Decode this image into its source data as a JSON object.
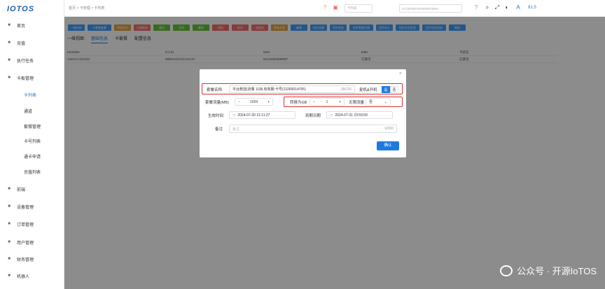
{
  "app": {
    "logo": "IOTOS",
    "breadcrumb": "首页 > 卡管理 > 卡列表"
  },
  "sidebar": {
    "items": [
      {
        "icon": "home-icon",
        "label": "首页"
      },
      {
        "icon": "recharge-icon",
        "label": "充值"
      },
      {
        "icon": "task-icon",
        "label": "执行任务"
      },
      {
        "icon": "card-icon",
        "label": "卡板管理"
      },
      {
        "icon": "",
        "label": "卡列表",
        "sub": true,
        "active": true
      },
      {
        "icon": "",
        "label": "通道",
        "sub": true
      },
      {
        "icon": "",
        "label": "套餐管理",
        "sub": true
      },
      {
        "icon": "",
        "label": "卡号列表",
        "sub": true
      },
      {
        "icon": "",
        "label": "通卡申请",
        "sub": true
      },
      {
        "icon": "",
        "label": "充值列表",
        "sub": true
      },
      {
        "icon": "link-icon",
        "label": "前端"
      },
      {
        "icon": "device-icon",
        "label": "设备管理"
      },
      {
        "icon": "order-icon",
        "label": "订单管理"
      },
      {
        "icon": "user-icon",
        "label": "用户管理"
      },
      {
        "icon": "finance-icon",
        "label": "财务管理"
      },
      {
        "icon": "robot-icon",
        "label": "机器人"
      }
    ]
  },
  "topbar": {
    "search_placeholder": "卡列表",
    "iccid_placeholder": "ICCID/MSISDN/IMSI/IMEI",
    "badge": "81.5"
  },
  "toolbar": {
    "buttons": [
      {
        "label": "一键分析",
        "color": "#409eff"
      },
      {
        "label": "卡套餐变更",
        "color": "#409eff"
      },
      {
        "label": "停机保号",
        "color": "#e6a23c"
      },
      {
        "label": "达量断网",
        "color": "#f56c6c"
      },
      {
        "label": "复机",
        "color": "#67c23a"
      },
      {
        "label": "开机",
        "color": "#67c23a"
      },
      {
        "label": "解绑",
        "color": "#67c23a"
      },
      {
        "label": "停机",
        "color": "#f56c6c"
      },
      {
        "label": "拆机",
        "color": "#f56c6c"
      },
      {
        "label": "流量池",
        "color": "#f56c6c"
      },
      {
        "label": "套餐充值",
        "color": "#e6a23c"
      },
      {
        "label": "编辑",
        "color": "#409eff"
      },
      {
        "label": "同步流量",
        "color": "#409eff"
      },
      {
        "label": "同步状态",
        "color": "#409eff"
      },
      {
        "label": "同步套餐详情",
        "color": "#409eff"
      },
      {
        "label": "同步机卡",
        "color": "#409eff"
      },
      {
        "label": "同步实名状态",
        "color": "#409eff"
      },
      {
        "label": "同步在线状态",
        "color": "#409eff"
      },
      {
        "label": "刷新",
        "color": "#409eff"
      }
    ]
  },
  "tabs": [
    "一维视图",
    "基础信息",
    "卡套餐",
    "配置信息"
  ],
  "grid": {
    "headers": [
      "MSISDN",
      "ICCID",
      "IMSI",
      "IMEI",
      "卡状态"
    ],
    "row": [
      "1440171231231",
      "89861231231231237",
      "81234594586987",
      "已激活",
      "已激活"
    ]
  },
  "dialog": {
    "name_label": "套餐名称",
    "name_value": "平台赠送(流量 1GB,有效期:卡号(13260014705)",
    "name_count": "28/125",
    "toggle_label": "复机&开机",
    "toggle_on": "是",
    "toggle_off": "否",
    "total_label": "套餐流量(MB)",
    "total_value": "1024",
    "convert_label": "转换为GB",
    "convert_value": "1",
    "unlimited_label": "无限流量",
    "unlimited_value": "否",
    "start_label": "生效时间",
    "start_value": "2024-07-20 21:11:27",
    "end_label": "到期日期",
    "end_value": "2024-07-31 23:59:59",
    "remark_label": "备注",
    "remark_placeholder": "备注",
    "remark_count": "0/200",
    "confirm": "确认"
  },
  "watermark": "公众号 · 开源IoTOS"
}
